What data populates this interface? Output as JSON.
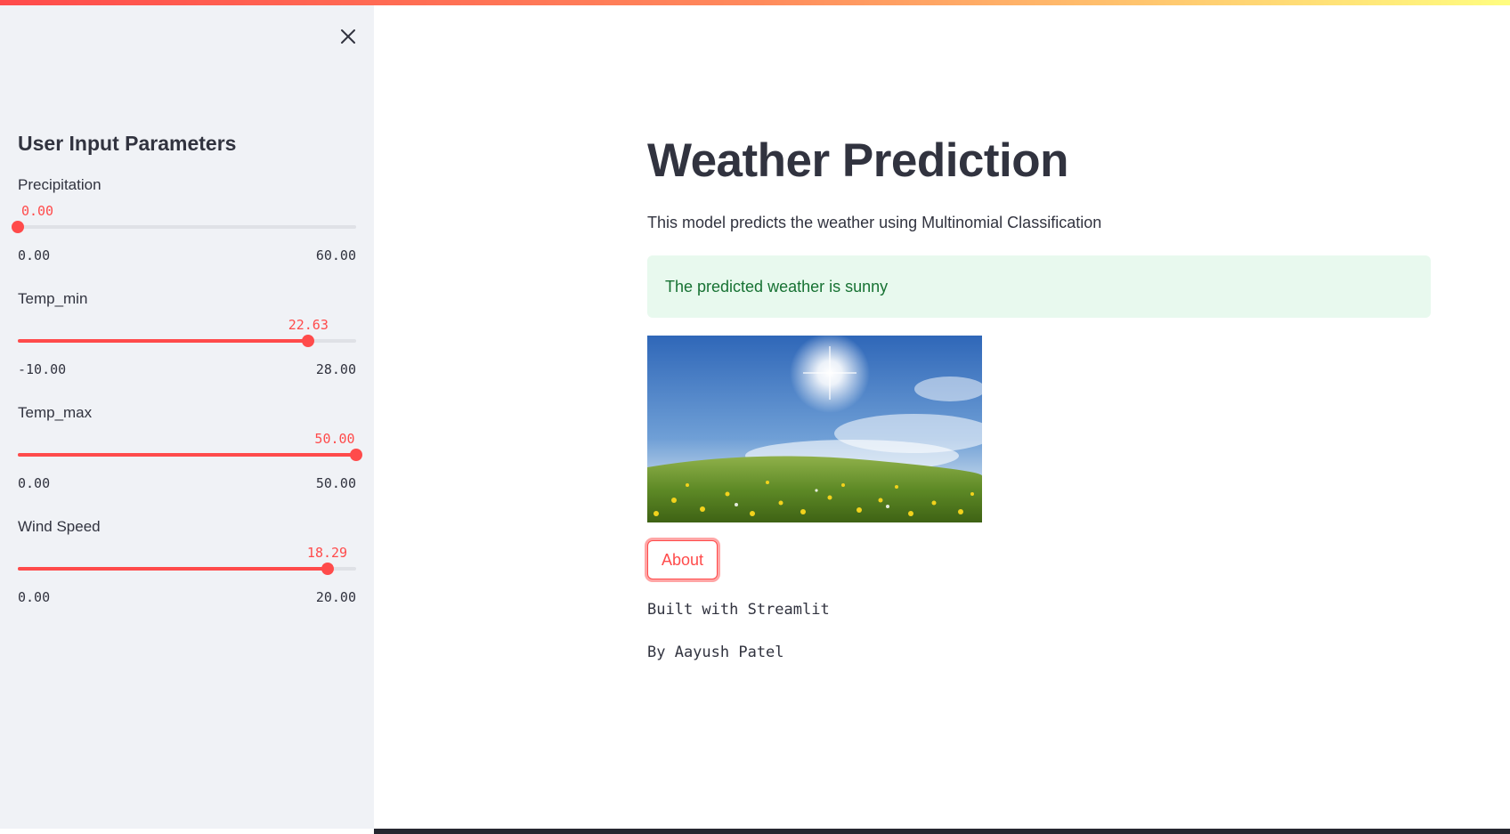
{
  "sidebar": {
    "title": "User Input Parameters",
    "sliders": [
      {
        "label": "Precipitation",
        "value": "0.00",
        "min": "0.00",
        "max": "60.00",
        "fraction": 0.0
      },
      {
        "label": "Temp_min",
        "value": "22.63",
        "min": "-10.00",
        "max": "28.00",
        "fraction": 0.8587
      },
      {
        "label": "Temp_max",
        "value": "50.00",
        "min": "0.00",
        "max": "50.00",
        "fraction": 1.0
      },
      {
        "label": "Wind Speed",
        "value": "18.29",
        "min": "0.00",
        "max": "20.00",
        "fraction": 0.9145
      }
    ]
  },
  "main": {
    "title": "Weather Prediction",
    "description": "This model predicts the weather using Multinomial Classification",
    "result": "The predicted weather is sunny",
    "about_button": "About",
    "built_with": "Built with Streamlit",
    "author": "By Aayush Patel"
  },
  "colors": {
    "accent": "#ff4b4b",
    "sidebar_bg": "#f0f2f6",
    "success_bg": "#e8f9ee",
    "success_text": "#177233",
    "text": "#31333f"
  }
}
